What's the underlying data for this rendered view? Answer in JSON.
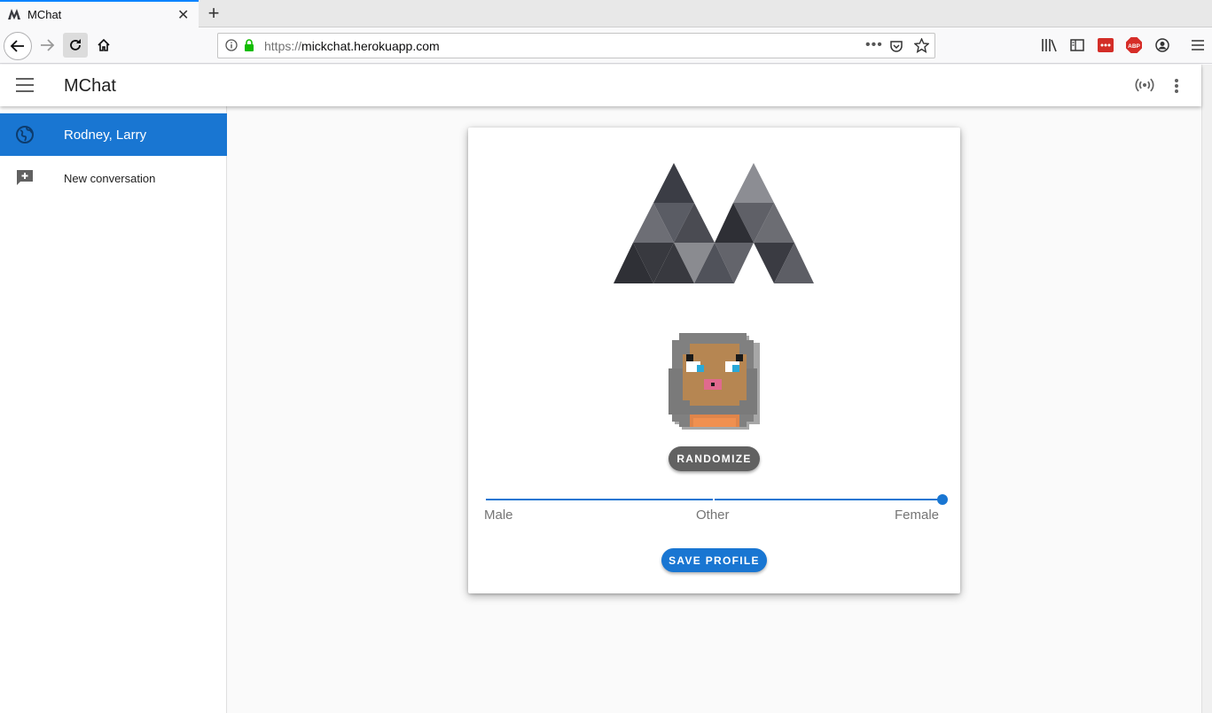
{
  "browser": {
    "tab_title": "MChat",
    "tab_close": "✕",
    "new_tab": "+",
    "url_scheme": "https://",
    "url_host": "mickchat.herokuapp.com",
    "url_more": "•••"
  },
  "app": {
    "title": "MChat",
    "accent_color": "#1976d2"
  },
  "sidebar": {
    "items": [
      {
        "label": "Rodney, Larry",
        "icon": "globe-icon",
        "active": true
      },
      {
        "label": "New conversation",
        "icon": "add-comment-icon",
        "active": false
      }
    ]
  },
  "profile": {
    "randomize_label": "RANDOMIZE",
    "gender_slider": {
      "labels": [
        "Male",
        "Other",
        "Female"
      ],
      "selected": "Female"
    },
    "save_label": "SAVE PROFILE"
  }
}
